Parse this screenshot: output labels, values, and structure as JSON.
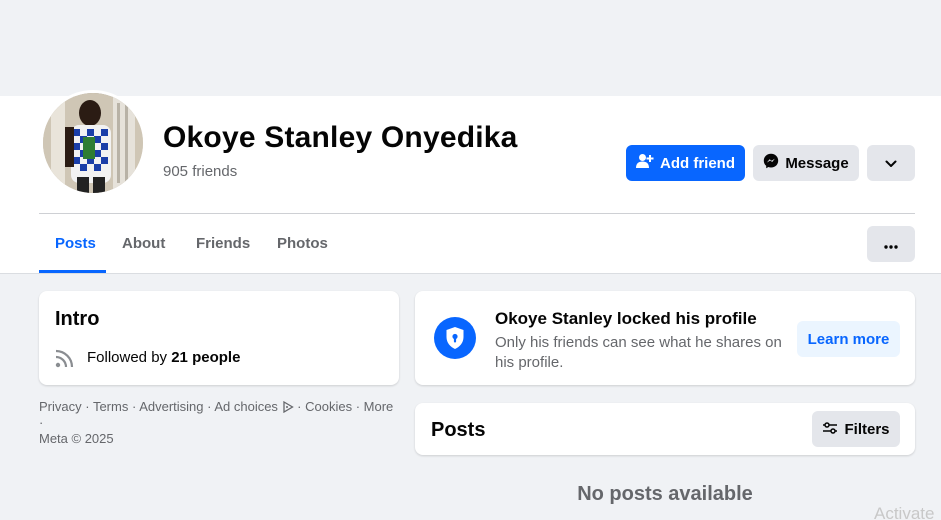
{
  "profile": {
    "name": "Okoye Stanley Onyedika",
    "friends_count": "905 friends"
  },
  "actions": {
    "add_friend": "Add friend",
    "message": "Message"
  },
  "tabs": [
    {
      "label": "Posts",
      "active": true
    },
    {
      "label": "About",
      "active": false
    },
    {
      "label": "Friends",
      "active": false
    },
    {
      "label": "Photos",
      "active": false
    }
  ],
  "intro": {
    "title": "Intro",
    "followed_prefix": "Followed by ",
    "followed_count": "21 people"
  },
  "footer": {
    "privacy": "Privacy",
    "terms": "Terms",
    "advertising": "Advertising",
    "ad_choices": "Ad choices",
    "cookies": "Cookies",
    "more": "More",
    "copyright": "Meta © 2025",
    "sep": " · "
  },
  "locked": {
    "title": "Okoye Stanley locked his profile",
    "text": "Only his friends can see what he shares on his profile.",
    "learn_more": "Learn more"
  },
  "posts": {
    "title": "Posts",
    "filters": "Filters",
    "empty": "No posts available"
  },
  "watermark": "Activate",
  "colors": {
    "accent": "#0866ff",
    "background": "#f0f2f5",
    "secondary_text": "#65676b"
  },
  "icons": [
    "add-friend-icon",
    "messenger-icon",
    "chevron-down-icon",
    "more-dots-icon",
    "rss-icon",
    "ad-choices-icon",
    "shield-lock-icon",
    "filters-icon"
  ]
}
